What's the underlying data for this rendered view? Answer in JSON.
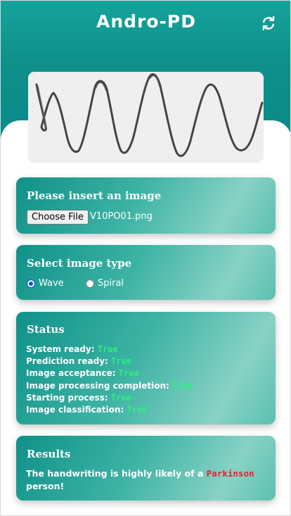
{
  "header": {
    "title": "Andro-PD",
    "refresh_icon": "refresh-icon"
  },
  "preview": {
    "image": "handwriting-wave-drawing"
  },
  "upload": {
    "title": "Please insert an image",
    "button_label": "Choose File",
    "file_name": "V10PO01.png"
  },
  "image_type": {
    "title": "Select image type",
    "options": [
      {
        "label": "Wave",
        "selected": true
      },
      {
        "label": "Spiral",
        "selected": false
      }
    ]
  },
  "status": {
    "title": "Status",
    "items": [
      {
        "label": "System ready:",
        "value": "True"
      },
      {
        "label": "Prediction ready:",
        "value": "True"
      },
      {
        "label": "Image acceptance:",
        "value": "True"
      },
      {
        "label": "Image processing completion:",
        "value": "True"
      },
      {
        "label": "Starting process:",
        "value": "True"
      },
      {
        "label": "Image classification:",
        "value": "True"
      }
    ]
  },
  "results": {
    "title": "Results",
    "text_before": "The handwriting is highly likely of a",
    "highlight": "Parkinson",
    "text_after": "person!"
  },
  "colors": {
    "header_teal": "#0e8f8a",
    "status_true": "#2ef07a",
    "result_highlight": "#e8202f",
    "radio_selected": "#0b57d0"
  }
}
